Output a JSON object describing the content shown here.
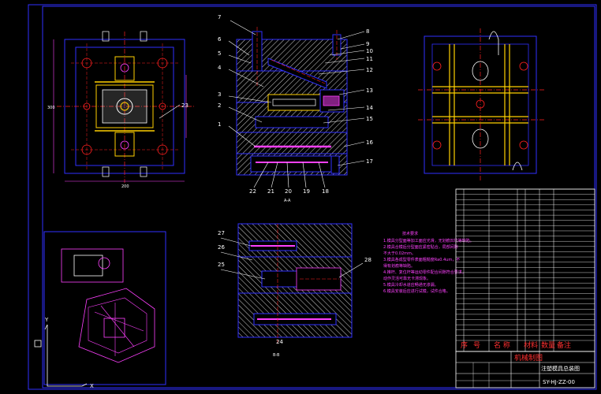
{
  "drawing": {
    "section_label_top": "A-A",
    "section_label_bottom": "B-B",
    "part_numbers_left": [
      "7",
      "6",
      "5",
      "4",
      "3",
      "2",
      "1"
    ],
    "part_numbers_right": [
      "8",
      "9",
      "10",
      "11",
      "12",
      "13",
      "14",
      "15",
      "16",
      "17"
    ],
    "part_numbers_bottom": [
      "22",
      "21",
      "20",
      "19",
      "18"
    ],
    "part_numbers_section_b_left": [
      "27",
      "26",
      "25"
    ],
    "part_numbers_section_b_right": [
      "28"
    ],
    "part_number_section_b_bottom": "24",
    "part_number_top_view": "23",
    "ucs_x": "X",
    "ucs_y": "Y"
  },
  "technical_notes": {
    "title": "技术要求",
    "lines": [
      "1.模具分型面等加工面应光滑，无划痕凹坑等缺陷。",
      "2.模具合模后分型面应紧密贴合，局部间隙",
      "  不大于0.02mm。",
      "3.模具各成型零件表面粗糙度Ra0.4um，不",
      "  得有划痕等缺陷。",
      "4.推杆、复位杆等运动零件配合间隙符合要求，",
      "  动作灵活可靠无卡滞现象。",
      "5.模具冷却水道应畅通无渗漏。",
      "6.模具安装后应进行试模，试件合格。"
    ]
  },
  "bom": {
    "header": [
      "序",
      "号",
      "名 称",
      "材料",
      "数量",
      "备注"
    ],
    "row_count": 29
  },
  "title_block": {
    "company": "机械制图",
    "drawing_title": "注塑模具总装图",
    "drawing_no": "SY-HJ-ZZ-00"
  },
  "colors": {
    "background": "#000000",
    "frame": "#3030ff",
    "outline": "#3030ff",
    "centerline": "#ff2020",
    "hatch": "#ffffff",
    "rib": "#ffd000",
    "part": "#ff40ff",
    "dimension": "#ff40ff"
  }
}
